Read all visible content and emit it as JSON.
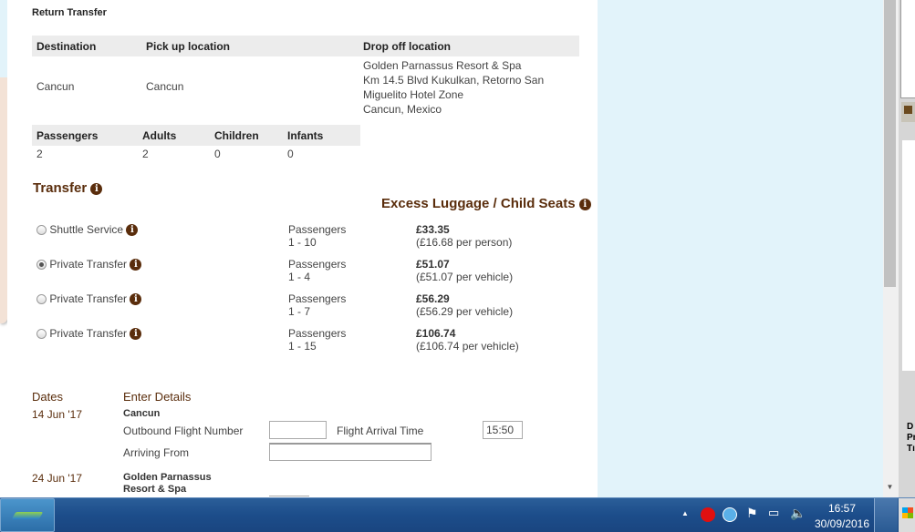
{
  "section_title": "Return Transfer",
  "route_table": {
    "headers": [
      "Destination",
      "Pick up location",
      "Drop off location"
    ],
    "destination": "Cancun",
    "pickup": "Cancun",
    "dropoff_lines": [
      "Golden Parnassus Resort & Spa",
      "Km 14.5 Blvd Kukulkan, Retorno San",
      "Miguelito Hotel Zone",
      "Cancun, Mexico"
    ]
  },
  "pax_table": {
    "headers": [
      "Passengers",
      "Adults",
      "Children",
      "Infants"
    ],
    "values": [
      "2",
      "2",
      "0",
      "0"
    ]
  },
  "transfer_heading": "Transfer",
  "extras_heading": "Excess Luggage / Child Seats",
  "options": [
    {
      "label": "Shuttle Service",
      "selected": false,
      "pax_label": "Passengers",
      "pax_range": "1 - 10",
      "price": "£33.35",
      "price_note": "(£16.68 per person)"
    },
    {
      "label": "Private Transfer",
      "selected": true,
      "pax_label": "Passengers",
      "pax_range": "1 - 4",
      "price": "£51.07",
      "price_note": "(£51.07 per vehicle)"
    },
    {
      "label": "Private Transfer",
      "selected": false,
      "pax_label": "Passengers",
      "pax_range": "1 - 7",
      "price": "£56.29",
      "price_note": "(£56.29 per vehicle)"
    },
    {
      "label": "Private Transfer",
      "selected": false,
      "pax_label": "Passengers",
      "pax_range": "1 - 15",
      "price": "£106.74",
      "price_note": "(£106.74 per vehicle)"
    }
  ],
  "details": {
    "dates_heading": "Dates",
    "enter_heading": "Enter Details",
    "leg1": {
      "date": "14 Jun '17",
      "place": "Cancun",
      "flight_label": "Outbound Flight Number",
      "flight_value": "",
      "arrival_label": "Flight Arrival Time",
      "arrival_value": "15:50",
      "from_label": "Arriving From",
      "from_value": ""
    },
    "leg2": {
      "date": "24 Jun '17",
      "place_line1": "Golden Parnassus",
      "place_line2": "Resort & Spa"
    }
  },
  "side_strip_text": [
    "D",
    "Pr",
    "Tı"
  ],
  "taskbar": {
    "time": "16:57",
    "date": "30/09/2016"
  }
}
